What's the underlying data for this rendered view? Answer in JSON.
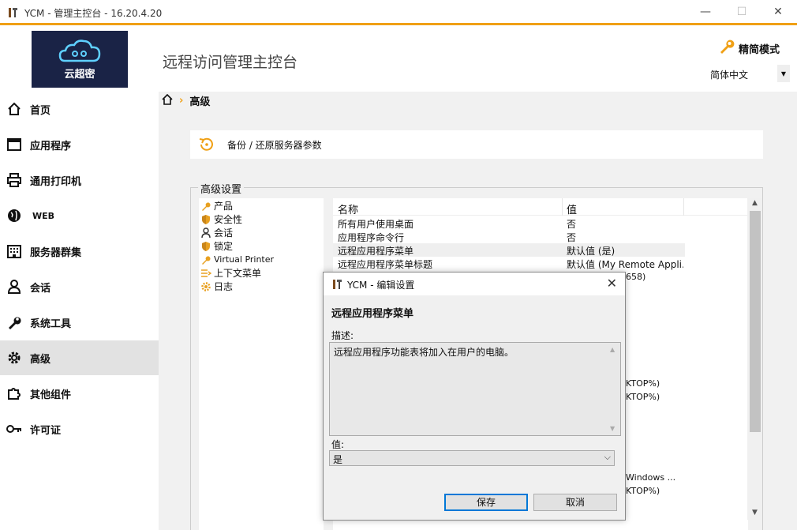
{
  "window": {
    "title": "YCM - 管理主控台 - 16.20.4.20",
    "minimize": "—",
    "maximize": "☐",
    "close": "✕"
  },
  "header": {
    "logo_text": "云超密",
    "page_title": "远程访问管理主控台",
    "mode_label": "精简模式",
    "language": "简体中文"
  },
  "sidebar": {
    "items": [
      {
        "label": "首页",
        "icon": "home-icon"
      },
      {
        "label": "应用程序",
        "icon": "window-icon"
      },
      {
        "label": "通用打印机",
        "icon": "printer-icon"
      },
      {
        "label": "WEB",
        "icon": "globe-icon"
      },
      {
        "label": "服务器群集",
        "icon": "building-icon"
      },
      {
        "label": "会话",
        "icon": "user-icon"
      },
      {
        "label": "系统工具",
        "icon": "wrench-icon"
      },
      {
        "label": "高级",
        "icon": "gear-icon"
      },
      {
        "label": "其他组件",
        "icon": "puzzle-icon"
      },
      {
        "label": "许可证",
        "icon": "key-icon"
      }
    ],
    "active_index": 7
  },
  "breadcrumb": {
    "current": "高级"
  },
  "backup": {
    "label": "备份 / 还原服务器参数"
  },
  "advanced": {
    "title": "高级设置",
    "tree": [
      {
        "label": "产品",
        "icon": "wrench-icon"
      },
      {
        "label": "安全性",
        "icon": "shield-icon"
      },
      {
        "label": "会话",
        "icon": "user-icon"
      },
      {
        "label": "锁定",
        "icon": "shield-icon"
      },
      {
        "label": "Virtual Printer",
        "icon": "printer-icon"
      },
      {
        "label": "上下文菜单",
        "icon": "menu-icon"
      },
      {
        "label": "日志",
        "icon": "gear-icon"
      }
    ],
    "columns": {
      "name": "名称",
      "value": "值"
    },
    "rows": [
      {
        "name": "所有用户使用桌面",
        "value": "否"
      },
      {
        "name": "应用程序命令行",
        "value": "否"
      },
      {
        "name": "远程应用程序菜单",
        "value": "默认值 (是)"
      },
      {
        "name": "远程应用程序菜单标题",
        "value": "默认值 (My Remote Appli..."
      }
    ],
    "selected_row": 2,
    "partial_values": [
      "658)",
      "KTOP%)",
      "KTOP%)",
      "Windows ...",
      "KTOP%)"
    ]
  },
  "dialog": {
    "title": "YCM - 编辑设置",
    "close": "✕",
    "heading": "远程应用程序菜单",
    "desc_label": "描述:",
    "description": "远程应用程序功能表将加入在用户的电脑。",
    "value_label": "值:",
    "value": "是",
    "save_label": "保存",
    "cancel_label": "取消"
  },
  "colors": {
    "accent": "#f0a015",
    "logo_bg": "#1a2346",
    "active_nav": "#e2e2e2",
    "focus_border": "#0078d7"
  }
}
